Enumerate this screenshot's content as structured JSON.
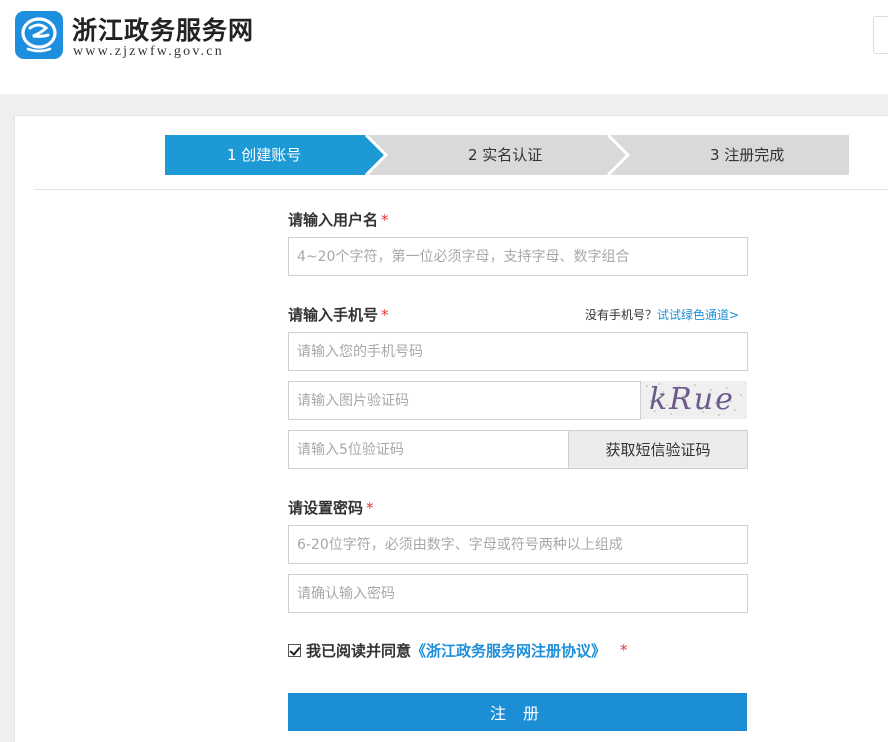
{
  "header": {
    "site_name": "浙江政务服务网",
    "site_url": "www.zjzwfw.gov.cn"
  },
  "steps": [
    {
      "label": "1 创建账号",
      "active": true
    },
    {
      "label": "2 实名认证",
      "active": false
    },
    {
      "label": "3 注册完成",
      "active": false
    }
  ],
  "form": {
    "username": {
      "label": "请输入用户名",
      "required_mark": "*",
      "placeholder": "4~20个字符，第一位必须字母，支持字母、数字组合",
      "value": ""
    },
    "phone": {
      "label": "请输入手机号",
      "required_mark": "*",
      "placeholder": "请输入您的手机号码",
      "value": "",
      "no_phone_text": "没有手机号？",
      "green_channel_link": "试试绿色通道>"
    },
    "image_code": {
      "placeholder": "请输入图片验证码",
      "value": "",
      "captcha_text": "kRue"
    },
    "sms_code": {
      "placeholder": "请输入5位验证码",
      "value": "",
      "button_label": "获取短信验证码"
    },
    "password": {
      "label": "请设置密码",
      "required_mark": "*",
      "placeholder": "6-20位字符，必须由数字、字母或符号两种以上组成",
      "value": ""
    },
    "confirm_password": {
      "placeholder": "请确认输入密码",
      "value": ""
    },
    "agreement": {
      "checked": true,
      "text": "我已阅读并同意",
      "link_text": "《浙江政务服务网注册协议》",
      "required_mark": "*"
    },
    "submit_label": "注 册"
  },
  "colors": {
    "accent": "#1b8ed6",
    "step_active": "#1d9ad6",
    "step_inactive": "#d9d9d9",
    "required": "#e3372f",
    "link": "#1e8fd8"
  },
  "icons": {
    "logo": "zj-logo-icon",
    "checkbox": "check-icon"
  }
}
